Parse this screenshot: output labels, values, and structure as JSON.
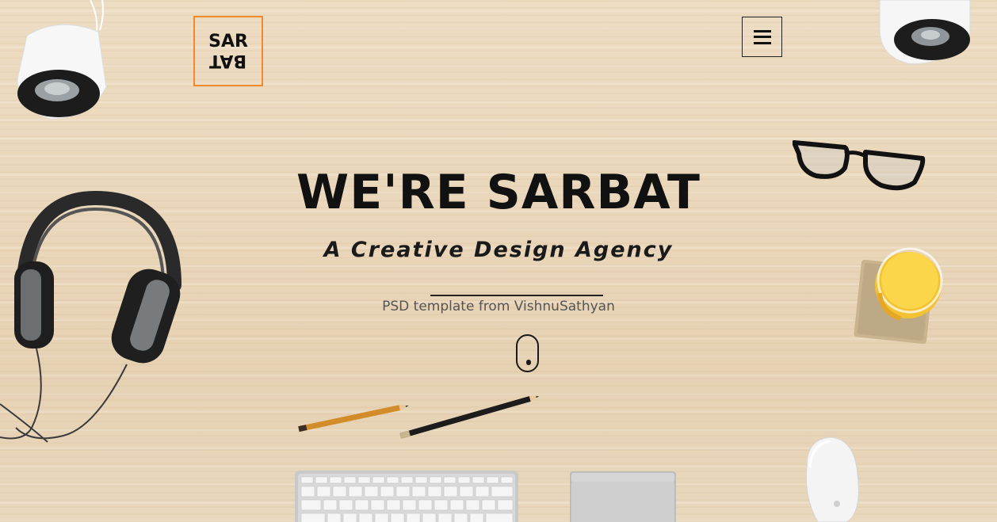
{
  "logo": {
    "top_text": "SAR",
    "bottom_text": "BAT",
    "border_color": "#f0892c"
  },
  "menu": {
    "icon": "hamburger-menu-icon"
  },
  "hero": {
    "title": "WE'RE SARBAT",
    "subtitle": "A Creative Design Agency",
    "credit": "PSD template from VishnuSathyan"
  },
  "scroll_indicator": {
    "icon": "mouse-scroll-icon"
  },
  "decorations": {
    "items": [
      "speaker-icon",
      "headphones-icon",
      "glasses-icon",
      "juice-glass-icon",
      "pencil-icon",
      "keyboard-icon",
      "trackpad-icon",
      "magic-mouse-icon"
    ]
  }
}
